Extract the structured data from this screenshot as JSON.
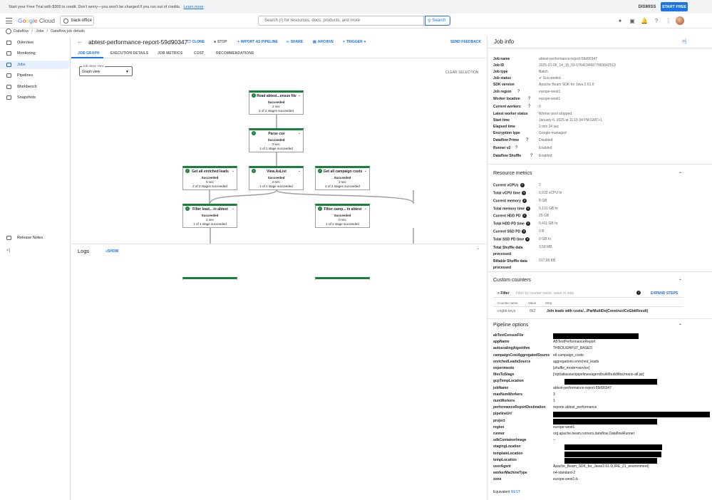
{
  "banner": {
    "text": "Start your Free Trial with $300 in credit. Don't worry—you won't be charged if you run out of credits.",
    "link": "Learn more",
    "dismiss": "DISMISS",
    "start": "START FREE"
  },
  "header": {
    "logo_google": "Google",
    "logo_cloud": "Cloud",
    "project": "back-office",
    "search_placeholder": "Search (/) for resources, docs, products, and more",
    "search_button": "Search"
  },
  "breadcrumbs": [
    "Dataflow",
    "/",
    "Jobs",
    "/",
    "Dataflow job details"
  ],
  "sidebar": {
    "items": [
      "Overview",
      "Monitoring",
      "Jobs",
      "Pipelines",
      "Workbench",
      "Snapshots"
    ],
    "release_notes": "Release Notes",
    "collapse": "<|"
  },
  "job": {
    "title": "abtest-performance-report-59d90347",
    "actions": [
      "CLONE",
      "STOP",
      "IMPORT AS PIPELINE",
      "SHARE",
      "ARCHIVE",
      "TRIGGER"
    ],
    "send_feedback": "SEND FEEDBACK"
  },
  "tabs": [
    "JOB GRAPH",
    "EXECUTION DETAILS",
    "JOB METRICS",
    "COST",
    "RECOMMENDATIONS"
  ],
  "graph": {
    "view_label": "Job steps view",
    "view_value": "Graph view",
    "clear": "CLEAR SELECTION",
    "nodes": [
      {
        "title": "Read abtest...ensus file",
        "status": "Succeeded",
        "dur": "2 sec",
        "stages": "2 of 2 stages succeeded"
      },
      {
        "title": "Parse csv",
        "status": "Succeeded",
        "dur": "0 sec",
        "stages": "1 of 1 stage succeeded"
      },
      {
        "title": "Get all enriched leads",
        "status": "Succeeded",
        "dur": "5 sec",
        "stages": "2 of 2 stages succeeded"
      },
      {
        "title": "View.AsList",
        "status": "Succeeded",
        "dur": "0 sec",
        "stages": "1 of 1 stage succeeded"
      },
      {
        "title": "Get all campaign costs",
        "status": "Succeeded",
        "dur": "2 sec",
        "stages": "2 of 2 stages succeeded"
      },
      {
        "title": "Filter lead... in abtest",
        "status": "Succeeded",
        "dur": "1 sec",
        "stages": "1 of 1 stage succeeded"
      },
      {
        "title": "Filter camp... in abtest",
        "status": "Succeeded",
        "dur": "0 sec",
        "stages": "1 of 1 stage succeeded"
      }
    ]
  },
  "logs": {
    "title": "Logs",
    "show": "SHOW"
  },
  "panel": {
    "title": "Job info",
    "close": ">|",
    "info": [
      [
        "Job name",
        "abtest-performance-report-59d90347",
        false
      ],
      [
        "Job ID",
        "2025-01-06_14_15_33-17641344977953642513",
        false
      ],
      [
        "Job type",
        "Batch",
        false
      ],
      [
        "Job status",
        "Succeeded",
        false
      ],
      [
        "SDK version",
        "Apache Beam SDK for Java 2.61.0",
        false
      ],
      [
        "Job region",
        "europe-west1",
        true
      ],
      [
        "Worker location",
        "europe-west1",
        true
      ],
      [
        "Current workers",
        "0",
        true
      ],
      [
        "Latest worker status",
        "Worker pool stopped.",
        false
      ],
      [
        "Start time",
        "January 6, 2025 at 11:15:34 PM GMT+1",
        false
      ],
      [
        "Elapsed time",
        "2 min 34 sec",
        false
      ],
      [
        "Encryption type",
        "Google-managed",
        false
      ],
      [
        "Dataflow Prime",
        "Disabled",
        true
      ],
      [
        "Runner v2",
        "Enabled",
        true
      ],
      [
        "Dataflow Shuffle",
        "Enabled",
        true
      ]
    ],
    "resource_title": "Resource metrics",
    "resources": [
      [
        "Current vCPUs",
        "2"
      ],
      [
        "Total vCPU time",
        "0,033 vCPU hr"
      ],
      [
        "Current memory",
        "8 GB"
      ],
      [
        "Total memory time",
        "0,131 GB hr"
      ],
      [
        "Current HDD PD",
        "25 GB"
      ],
      [
        "Total HDD PD time",
        "0,411 GB hr"
      ],
      [
        "Current SSD PD",
        "0 B"
      ],
      [
        "Total SSD PD time",
        "0 GB hr"
      ],
      [
        "Total Shuffle data processed",
        "3,58 MB"
      ],
      [
        "Billable Shuffle data processed",
        "917,65 KB"
      ]
    ],
    "counters_title": "Custom counters",
    "filter_label": "Filter",
    "filter_placeholder": "Filter by counter name, value or step",
    "expand": "EXPAND STEPS",
    "counter_headers": [
      "Counter name",
      "Value",
      "Step"
    ],
    "counter_row": [
      "cogbk-keys",
      "862",
      "Join leads with costs/.../ParMultiDo(ConstructCoGbkResult)"
    ],
    "pipeline_title": "Pipeline options",
    "options": [
      [
        "abTestCensusFile",
        ""
      ],
      [
        "appName",
        "ABTestPerformanceReport"
      ],
      [
        "autoscalingAlgorithm",
        "THROUGHPUT_BASED"
      ],
      [
        "campaignCostAggregatedSource",
        "etl.campaign_costs"
      ],
      [
        "enrichedLeadsSource",
        "aggregations.enriched_leads"
      ],
      [
        "experiments",
        "[shuffle_mode=service]"
      ],
      [
        "filesToStage",
        "[/opt/atlassian/pipelines/agent/build/build/libs/mario-all.jar]"
      ],
      [
        "gcpTempLocation",
        ""
      ],
      [
        "jobName",
        "abtest-performance-report-59d90347"
      ],
      [
        "maxNumWorkers",
        "3"
      ],
      [
        "numWorkers",
        "1"
      ],
      [
        "performanceReportDestination",
        "reports.abtest_performance"
      ],
      [
        "pipelineUrl",
        ""
      ],
      [
        "project",
        ""
      ],
      [
        "region",
        "europe-west1"
      ],
      [
        "runner",
        "org.apache.beam.runners.dataflow.DataflowRunner"
      ],
      [
        "sdkContainerImage",
        "--"
      ],
      [
        "stagingLocation",
        ""
      ],
      [
        "templateLocation",
        ""
      ],
      [
        "tempLocation",
        ""
      ],
      [
        "userAgent",
        "Apache_Beam_SDK_for_Java/2.61.0(JRE_21_environment)"
      ],
      [
        "workerMachineType",
        "n4-standard-2"
      ],
      [
        "zone",
        "europe-west1-b"
      ]
    ],
    "equivalent": "Equivalent",
    "rest": "REST"
  }
}
